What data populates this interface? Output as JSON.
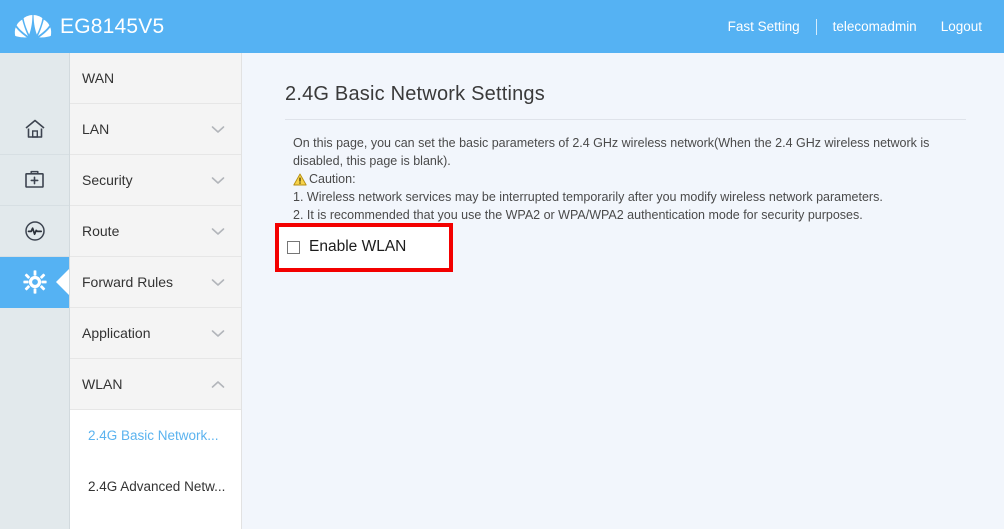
{
  "header": {
    "brand_name": "EG8145V5",
    "logo_icon": "huawei-flower-logo",
    "fast_setting": "Fast Setting",
    "username": "telecomadmin",
    "logout": "Logout"
  },
  "icon_rail": {
    "items": [
      {
        "icon": "home-icon",
        "active": false
      },
      {
        "icon": "toolkit-icon",
        "active": false
      },
      {
        "icon": "diagnostics-pulse-icon",
        "active": false
      },
      {
        "icon": "gear-icon",
        "active": true
      }
    ]
  },
  "menu": {
    "items": [
      {
        "label": "WAN",
        "chevron": "none"
      },
      {
        "label": "LAN",
        "chevron": "down"
      },
      {
        "label": "Security",
        "chevron": "down"
      },
      {
        "label": "Route",
        "chevron": "down"
      },
      {
        "label": "Forward Rules",
        "chevron": "down"
      },
      {
        "label": "Application",
        "chevron": "down"
      },
      {
        "label": "WLAN",
        "chevron": "up"
      }
    ],
    "submenu": [
      {
        "label": "2.4G Basic Network...",
        "active": true
      },
      {
        "label": "2.4G Advanced Netw...",
        "active": false
      }
    ]
  },
  "content": {
    "title": "2.4G Basic Network Settings",
    "description_line1": "On this page, you can set the basic parameters of 2.4 GHz wireless network(When the 2.4 GHz wireless network is disabled, this page is blank).",
    "caution_icon": "warning-triangle-icon",
    "caution_label": "Caution:",
    "caution_1": "1. Wireless network services may be interrupted temporarily after you modify wireless network parameters.",
    "caution_2": "2. It is recommended that you use the WPA2 or WPA/WPA2 authentication mode for security purposes.",
    "enable_wlan": {
      "label": "Enable WLAN",
      "checked": false
    }
  },
  "colors": {
    "header_blue": "#55b2f3",
    "accent_blue": "#5bb3ef",
    "highlight_red": "#f30000",
    "content_bg": "#f2f6fc",
    "rail_bg": "#e2e9ec",
    "menu_item_bg": "#f4f4f4",
    "caution_yellow": "#f5c518"
  }
}
